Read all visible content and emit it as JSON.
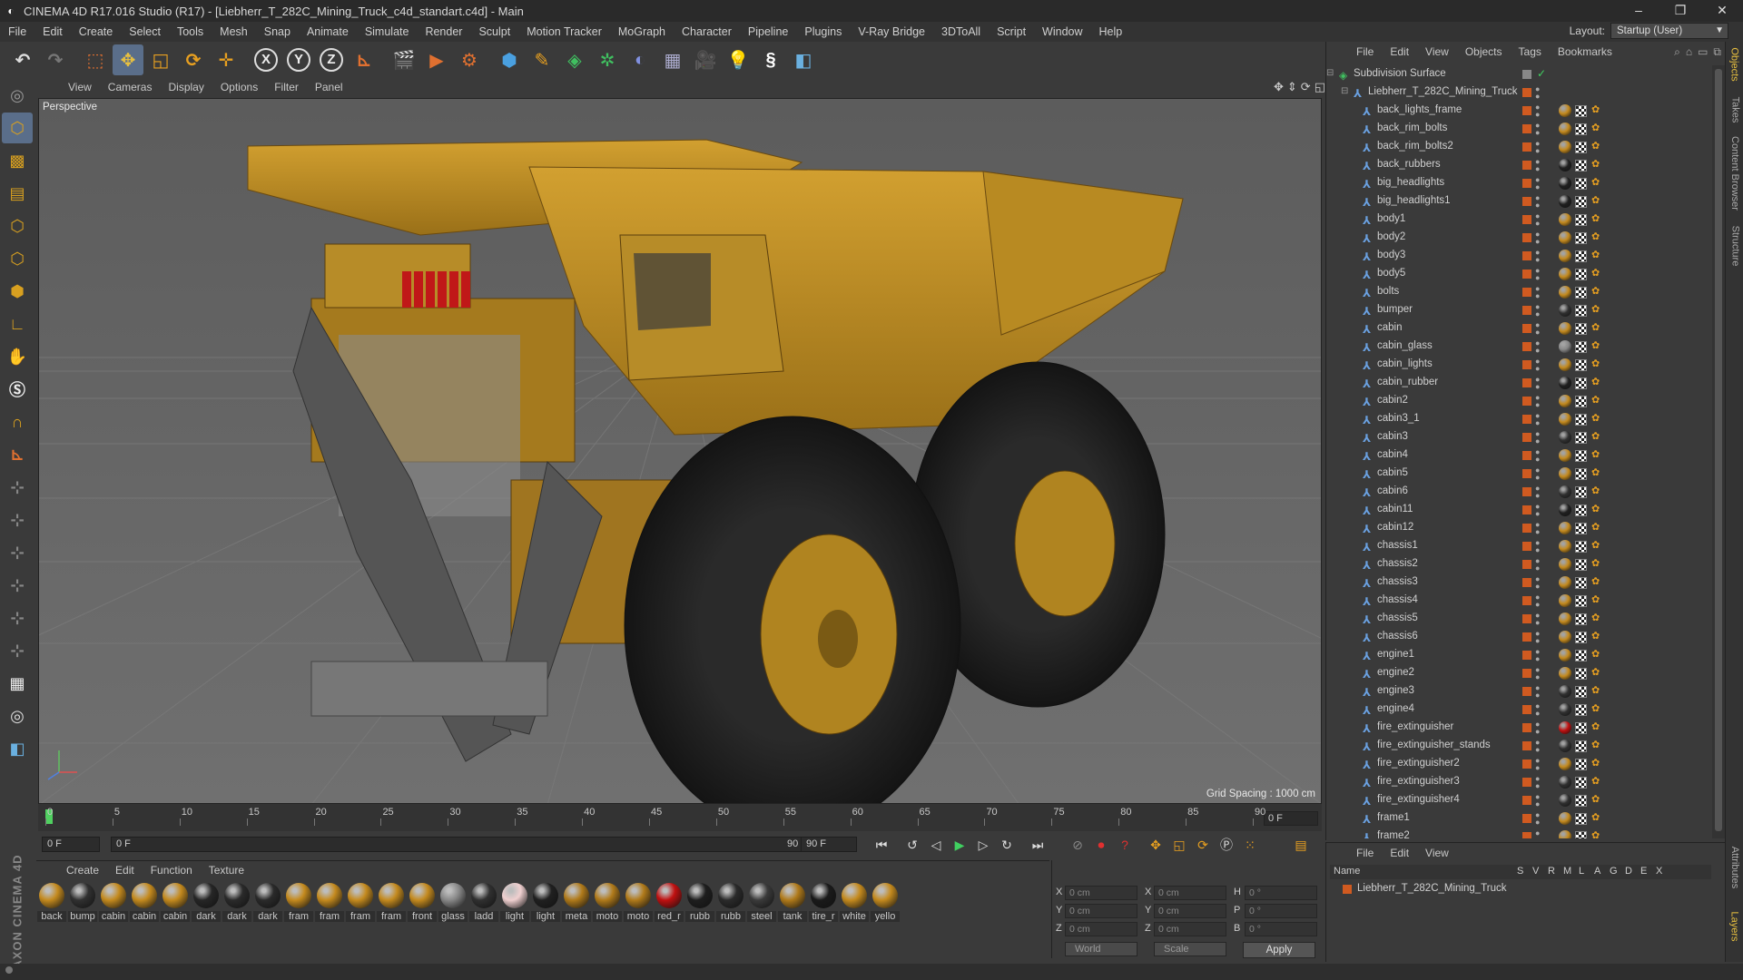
{
  "window": {
    "title": "CINEMA 4D R17.016 Studio (R17) - [Liebherr_T_282C_Mining_Truck_c4d_standart.c4d] - Main",
    "minimize": "–",
    "restore": "❐",
    "close": "✕"
  },
  "menu": [
    "File",
    "Edit",
    "Create",
    "Select",
    "Tools",
    "Mesh",
    "Snap",
    "Animate",
    "Simulate",
    "Render",
    "Sculpt",
    "Motion Tracker",
    "MoGraph",
    "Character",
    "Pipeline",
    "Plugins",
    "V-Ray Bridge",
    "3DToAll",
    "Script",
    "Window",
    "Help"
  ],
  "layout": {
    "label": "Layout:",
    "value": "Startup (User)"
  },
  "toolbar": {
    "x": "X",
    "y": "Y",
    "z": "Z"
  },
  "viewport": {
    "menu": [
      "View",
      "Cameras",
      "Display",
      "Options",
      "Filter",
      "Panel"
    ],
    "label": "Perspective",
    "grid_spacing": "Grid Spacing : 1000 cm"
  },
  "timeline": {
    "ticks": [
      "0",
      "5",
      "10",
      "15",
      "20",
      "25",
      "30",
      "35",
      "40",
      "45",
      "50",
      "55",
      "60",
      "65",
      "70",
      "75",
      "80",
      "85",
      "90"
    ],
    "frame": "0 F"
  },
  "playbar": {
    "start": "0 F",
    "slider_left": "0 F",
    "slider_right": "90 F",
    "end": "90 F"
  },
  "materials": {
    "menu": [
      "Create",
      "Edit",
      "Function",
      "Texture"
    ],
    "items": [
      {
        "name": "back",
        "color": "#c48a1e"
      },
      {
        "name": "bump",
        "color": "#303030"
      },
      {
        "name": "cabin",
        "color": "#c48a1e"
      },
      {
        "name": "cabin",
        "color": "#c48a1e"
      },
      {
        "name": "cabin",
        "color": "#c48a1e"
      },
      {
        "name": "dark",
        "color": "#262626"
      },
      {
        "name": "dark",
        "color": "#2a2a2a"
      },
      {
        "name": "dark",
        "color": "#2a2a2a"
      },
      {
        "name": "fram",
        "color": "#c48a1e"
      },
      {
        "name": "fram",
        "color": "#c48a1e"
      },
      {
        "name": "fram",
        "color": "#c48a1e"
      },
      {
        "name": "fram",
        "color": "#c48a1e"
      },
      {
        "name": "front",
        "color": "#c48a1e"
      },
      {
        "name": "glass",
        "color": "#888888"
      },
      {
        "name": "ladd",
        "color": "#303030"
      },
      {
        "name": "light",
        "color": "#f0d0d0"
      },
      {
        "name": "light",
        "color": "#202020"
      },
      {
        "name": "meta",
        "color": "#b07a1a"
      },
      {
        "name": "moto",
        "color": "#b07a1a"
      },
      {
        "name": "moto",
        "color": "#b07a1a"
      },
      {
        "name": "red_r",
        "color": "#c01010"
      },
      {
        "name": "rubb",
        "color": "#1e1e1e"
      },
      {
        "name": "rubb",
        "color": "#2a2a2a"
      },
      {
        "name": "steel",
        "color": "#3a3a3a"
      },
      {
        "name": "tank",
        "color": "#b07a1a"
      },
      {
        "name": "tire_r",
        "color": "#1a1a1a"
      },
      {
        "name": "white",
        "color": "#c48a1e"
      },
      {
        "name": "yello",
        "color": "#c48a1e"
      }
    ]
  },
  "coords": {
    "x": "X",
    "y": "Y",
    "z": "Z",
    "h": "H",
    "p": "P",
    "b": "B",
    "pos_x": "0 cm",
    "pos_y": "0 cm",
    "pos_z": "0 cm",
    "size_x": "0 cm",
    "size_y": "0 cm",
    "size_z": "0 cm",
    "rot_h": "0 °",
    "rot_p": "0 °",
    "rot_b": "0 °",
    "mode": "World",
    "scale": "Scale",
    "apply": "Apply"
  },
  "objects": {
    "menu": [
      "File",
      "Edit",
      "View",
      "Objects",
      "Tags",
      "Bookmarks"
    ],
    "root": "Subdivision Surface",
    "group": "Liebherr_T_282C_Mining_Truck",
    "children": [
      {
        "name": "back_lights_frame",
        "tag": "#c48a1e"
      },
      {
        "name": "back_rim_bolts",
        "tag": "#c48a1e"
      },
      {
        "name": "back_rim_bolts2",
        "tag": "#c48a1e"
      },
      {
        "name": "back_rubbers",
        "tag": "#202020"
      },
      {
        "name": "big_headlights",
        "tag": "#202020"
      },
      {
        "name": "big_headlights1",
        "tag": "#202020"
      },
      {
        "name": "body1",
        "tag": "#c48a1e"
      },
      {
        "name": "body2",
        "tag": "#c48a1e"
      },
      {
        "name": "body3",
        "tag": "#c48a1e"
      },
      {
        "name": "body5",
        "tag": "#c48a1e"
      },
      {
        "name": "bolts",
        "tag": "#c48a1e"
      },
      {
        "name": "bumper",
        "tag": "#303030"
      },
      {
        "name": "cabin",
        "tag": "#c48a1e"
      },
      {
        "name": "cabin_glass",
        "tag": "#888888"
      },
      {
        "name": "cabin_lights",
        "tag": "#c48a1e"
      },
      {
        "name": "cabin_rubber",
        "tag": "#202020"
      },
      {
        "name": "cabin2",
        "tag": "#c48a1e"
      },
      {
        "name": "cabin3_1",
        "tag": "#c48a1e"
      },
      {
        "name": "cabin3",
        "tag": "#303030"
      },
      {
        "name": "cabin4",
        "tag": "#c48a1e"
      },
      {
        "name": "cabin5",
        "tag": "#c48a1e"
      },
      {
        "name": "cabin6",
        "tag": "#303030"
      },
      {
        "name": "cabin11",
        "tag": "#202020"
      },
      {
        "name": "cabin12",
        "tag": "#c48a1e"
      },
      {
        "name": "chassis1",
        "tag": "#c48a1e"
      },
      {
        "name": "chassis2",
        "tag": "#c48a1e"
      },
      {
        "name": "chassis3",
        "tag": "#c48a1e"
      },
      {
        "name": "chassis4",
        "tag": "#c48a1e"
      },
      {
        "name": "chassis5",
        "tag": "#c48a1e"
      },
      {
        "name": "chassis6",
        "tag": "#c48a1e"
      },
      {
        "name": "engine1",
        "tag": "#c48a1e"
      },
      {
        "name": "engine2",
        "tag": "#c48a1e"
      },
      {
        "name": "engine3",
        "tag": "#303030"
      },
      {
        "name": "engine4",
        "tag": "#303030"
      },
      {
        "name": "fire_extinguisher",
        "tag": "#c01010"
      },
      {
        "name": "fire_extinguisher_stands",
        "tag": "#303030"
      },
      {
        "name": "fire_extinguisher2",
        "tag": "#c48a1e"
      },
      {
        "name": "fire_extinguisher3",
        "tag": "#303030"
      },
      {
        "name": "fire_extinguisher4",
        "tag": "#303030"
      },
      {
        "name": "frame1",
        "tag": "#c48a1e"
      },
      {
        "name": "frame2",
        "tag": "#c48a1e"
      }
    ]
  },
  "layers": {
    "menu": [
      "File",
      "Edit",
      "View"
    ],
    "cols": [
      "Name",
      "S",
      "V",
      "R",
      "M",
      "L",
      "A",
      "G",
      "D",
      "E",
      "X"
    ],
    "row": "Liebherr_T_282C_Mining_Truck"
  },
  "right_tabs": [
    "Objects",
    "Takes",
    "Content Browser",
    "Structure",
    "Attributes",
    "Layers"
  ]
}
